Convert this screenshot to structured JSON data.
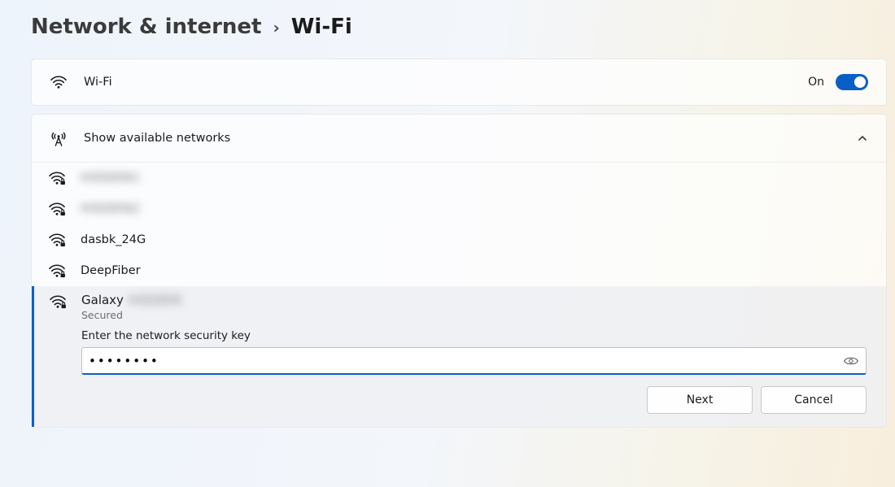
{
  "breadcrumb": {
    "parent": "Network & internet",
    "current": "Wi-Fi"
  },
  "wifi_toggle": {
    "label": "Wi-Fi",
    "state": "On",
    "on": true
  },
  "available": {
    "header": "Show available networks",
    "expanded": true
  },
  "networks": [
    {
      "ssid": "HIDDEN1",
      "blurred": true
    },
    {
      "ssid": "HIDDEN2",
      "blurred": true
    },
    {
      "ssid": "dasbk_24G",
      "blurred": false
    },
    {
      "ssid": "DeepFiber",
      "blurred": false
    }
  ],
  "selected": {
    "ssid_prefix": "Galaxy",
    "ssid_suffix": "HIDDEN",
    "secured_label": "Secured",
    "prompt": "Enter the network security key",
    "password_value": "••••••••",
    "next_label": "Next",
    "cancel_label": "Cancel"
  }
}
